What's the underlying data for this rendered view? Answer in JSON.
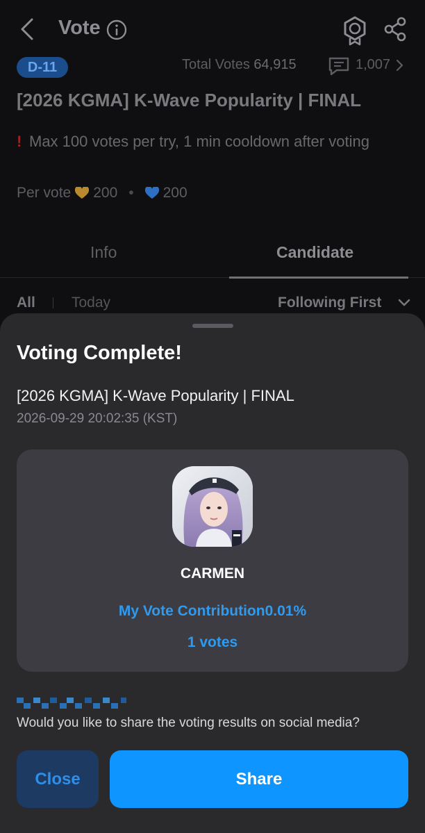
{
  "header": {
    "title": "Vote",
    "back_icon": "chevron-left-icon",
    "info_icon": "info-icon",
    "medal_icon": "medal-icon",
    "share_icon": "share-icon"
  },
  "vote": {
    "dday": "D-11",
    "total_label": "Total Votes",
    "total_value": "64,915",
    "comment_count": "1,007",
    "title": "[2026 KGMA] K-Wave Popularity | FINAL",
    "notice_mark": "!",
    "notice": "Max 100 votes per try, 1 min cooldown after voting",
    "per_vote_label": "Per vote",
    "gold_cost": "200",
    "blue_cost": "200",
    "gold_heart_color": "#b98a2d",
    "blue_heart_color": "#2d6fc4"
  },
  "tabs": {
    "info": "Info",
    "candidate": "Candidate",
    "active": "candidate"
  },
  "filters": {
    "all": "All",
    "today": "Today",
    "sort": "Following First"
  },
  "sheet": {
    "title": "Voting Complete!",
    "vote_title": "[2026 KGMA] K-Wave Popularity | FINAL",
    "timestamp": "2026-09-29 20:02:35 (KST)",
    "candidate_name": "CARMEN",
    "contribution": "My Vote Contribution0.01%",
    "votes": "1 votes",
    "share_question": "Would you like to share the voting results on social media?",
    "close_button": "Close",
    "share_button": "Share"
  },
  "colors": {
    "accent": "#0f95ff",
    "accent_text": "#2f9bf0",
    "sheet_bg": "#2a2a2d",
    "card_bg": "#3c3c42"
  }
}
